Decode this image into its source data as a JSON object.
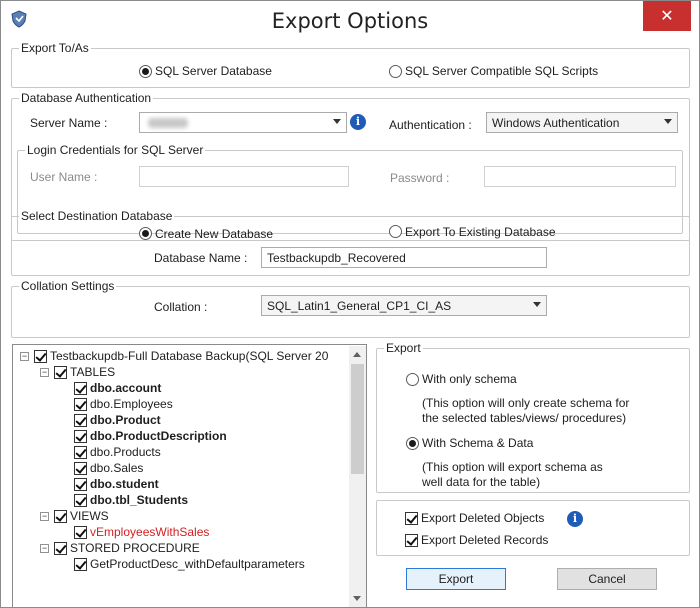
{
  "window": {
    "title": "Export Options",
    "close_glyph": "✕",
    "logo_icon": "app-shield-icon"
  },
  "export_to": {
    "legend": "Export To/As",
    "options": [
      {
        "label": "SQL Server Database",
        "selected": true
      },
      {
        "label": "SQL Server Compatible SQL Scripts",
        "selected": false
      }
    ]
  },
  "db_auth": {
    "legend": "Database Authentication",
    "server_label": "Server Name :",
    "server_value": "",
    "auth_label": "Authentication :",
    "auth_value": "Windows Authentication",
    "login": {
      "legend": "Login Credentials for SQL Server",
      "user_label": "User Name :",
      "user_value": "",
      "password_label": "Password :",
      "password_value": ""
    }
  },
  "destination": {
    "legend": "Select Destination Database",
    "options": [
      {
        "label": "Create New Database",
        "selected": true
      },
      {
        "label": "Export To Existing Database",
        "selected": false
      }
    ],
    "dbname_label": "Database Name :",
    "dbname_value": "Testbackupdb_Recovered"
  },
  "collation": {
    "legend": "Collation Settings",
    "label": "Collation :",
    "value": "SQL_Latin1_General_CP1_CI_AS"
  },
  "tree": {
    "root": "Testbackupdb-Full Database Backup(SQL Server 20",
    "tables_label": "TABLES",
    "tables": [
      {
        "label": "dbo.account",
        "bold": true
      },
      {
        "label": "dbo.Employees",
        "bold": false
      },
      {
        "label": "dbo.Product",
        "bold": true
      },
      {
        "label": "dbo.ProductDescription",
        "bold": true
      },
      {
        "label": "dbo.Products",
        "bold": false
      },
      {
        "label": "dbo.Sales",
        "bold": false
      },
      {
        "label": "dbo.student",
        "bold": true
      },
      {
        "label": "dbo.tbl_Students",
        "bold": true
      }
    ],
    "views_label": "VIEWS",
    "views": [
      {
        "label": "vEmployeesWithSales",
        "red": true
      }
    ],
    "procs_label": "STORED PROCEDURE",
    "procs": [
      {
        "label": "GetProductDesc_withDefaultparameters"
      }
    ]
  },
  "export_group": {
    "legend": "Export",
    "schema_only_label": "With only schema",
    "schema_only_note_1": "(This option will only create schema for",
    "schema_only_note_2": "the  selected tables/views/ procedures)",
    "schema_data_label": "With Schema & Data",
    "schema_data_note_1": "(This option will export schema as",
    "schema_data_note_2": "well data for the table)",
    "selected": "schema_data"
  },
  "deleted": {
    "objects_label": "Export Deleted Objects",
    "records_label": "Export Deleted Records",
    "objects_checked": true,
    "records_checked": true
  },
  "buttons": {
    "export_label": "Export",
    "cancel_label": "Cancel"
  },
  "colors": {
    "close_red": "#c7302f",
    "info_blue": "#1f5cb8",
    "view_red": "#d42020"
  }
}
